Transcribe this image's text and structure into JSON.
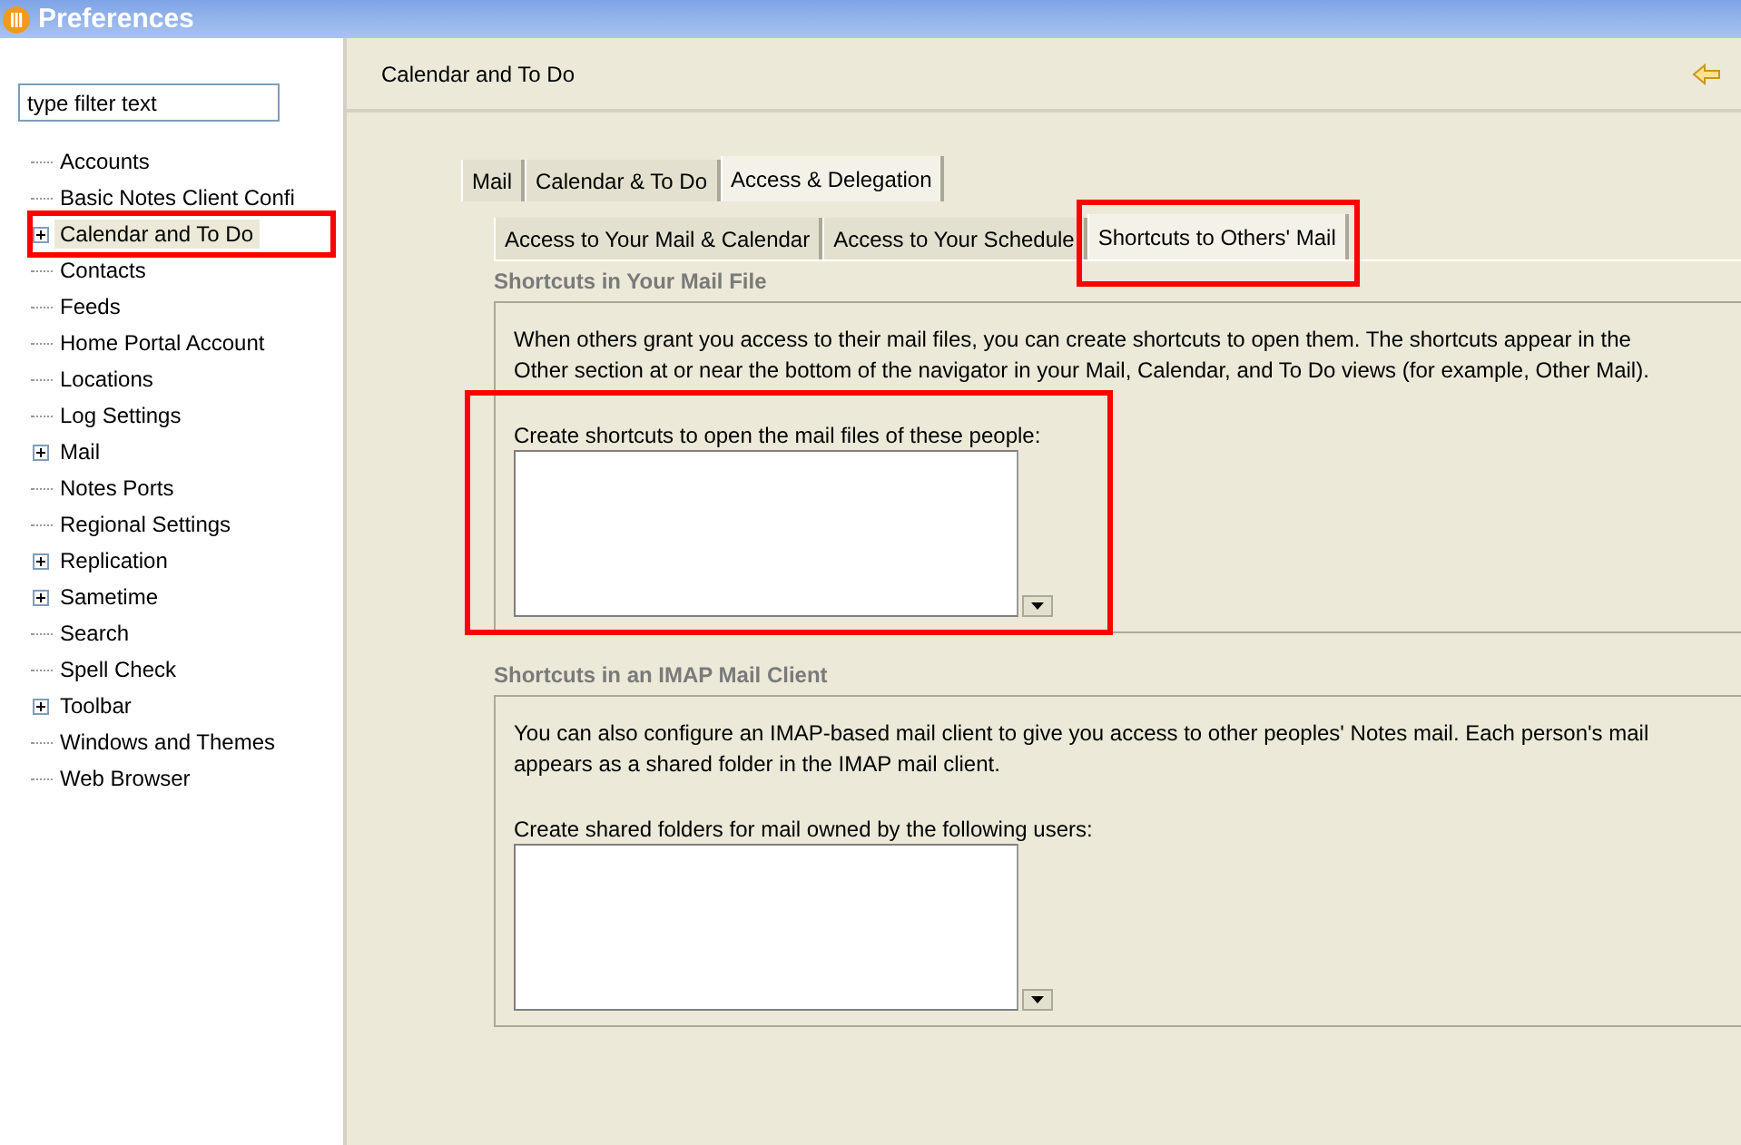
{
  "window": {
    "title": "Preferences"
  },
  "filter": {
    "value": "type filter text"
  },
  "tree": [
    {
      "label": "Accounts",
      "expandable": false,
      "selected": false,
      "highlighted": false
    },
    {
      "label": "Basic Notes Client Confi",
      "expandable": false,
      "selected": false,
      "highlighted": false
    },
    {
      "label": "Calendar and To Do",
      "expandable": true,
      "selected": true,
      "highlighted": true
    },
    {
      "label": "Contacts",
      "expandable": false,
      "selected": false,
      "highlighted": false
    },
    {
      "label": "Feeds",
      "expandable": false,
      "selected": false,
      "highlighted": false
    },
    {
      "label": "Home Portal Account",
      "expandable": false,
      "selected": false,
      "highlighted": false
    },
    {
      "label": "Locations",
      "expandable": false,
      "selected": false,
      "highlighted": false
    },
    {
      "label": "Log Settings",
      "expandable": false,
      "selected": false,
      "highlighted": false
    },
    {
      "label": "Mail",
      "expandable": true,
      "selected": false,
      "highlighted": false
    },
    {
      "label": "Notes Ports",
      "expandable": false,
      "selected": false,
      "highlighted": false
    },
    {
      "label": "Regional Settings",
      "expandable": false,
      "selected": false,
      "highlighted": false
    },
    {
      "label": "Replication",
      "expandable": true,
      "selected": false,
      "highlighted": false
    },
    {
      "label": "Sametime",
      "expandable": true,
      "selected": false,
      "highlighted": false
    },
    {
      "label": "Search",
      "expandable": false,
      "selected": false,
      "highlighted": false
    },
    {
      "label": "Spell Check",
      "expandable": false,
      "selected": false,
      "highlighted": false
    },
    {
      "label": "Toolbar",
      "expandable": true,
      "selected": false,
      "highlighted": false
    },
    {
      "label": "Windows and Themes",
      "expandable": false,
      "selected": false,
      "highlighted": false
    },
    {
      "label": "Web Browser",
      "expandable": false,
      "selected": false,
      "highlighted": false
    }
  ],
  "page_title": "Calendar and To Do",
  "tabs": [
    {
      "label": "Mail",
      "selected": false
    },
    {
      "label": "Calendar & To Do",
      "selected": false
    },
    {
      "label": "Access & Delegation",
      "selected": true
    }
  ],
  "subtabs": [
    {
      "label": "Access to Your Mail & Calendar",
      "selected": false,
      "highlighted": false
    },
    {
      "label": "Access to Your Schedule",
      "selected": false,
      "highlighted": false
    },
    {
      "label": "Shortcuts to Others' Mail",
      "selected": true,
      "highlighted": true
    }
  ],
  "groups": [
    {
      "title": "Shortcuts in Your Mail File",
      "text": "When others grant you access to their mail files, you can create shortcuts to open them. The shortcuts appear in the Other section at or near the bottom of the navigator in your Mail, Calendar, and To Do views (for example, Other Mail).",
      "field_label": "Create shortcuts to open the mail files of these people:",
      "highlighted": true
    },
    {
      "title": "Shortcuts in an IMAP Mail Client",
      "text": "You can also configure an IMAP-based mail client to give you access to other peoples' Notes mail. Each person's mail appears as a shared folder in the IMAP mail client.",
      "field_label": "Create shared folders for mail owned by the following users:",
      "highlighted": false
    }
  ]
}
